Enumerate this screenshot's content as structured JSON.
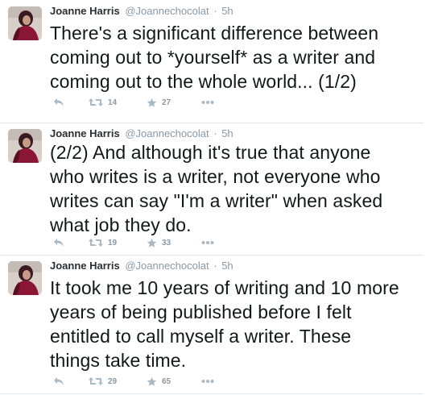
{
  "tweets": [
    {
      "fullname": "Joanne Harris",
      "username": "@Joannechocolat",
      "separator": "·",
      "time": "5h",
      "text": "There's a significant difference between\ncoming out to *yourself* as a writer and\ncoming out to the whole world... (1/2)",
      "retweets": "14",
      "favorites": "27"
    },
    {
      "fullname": "Joanne Harris",
      "username": "@Joannechocolat",
      "separator": "·",
      "time": "5h",
      "text": "(2/2) And although it's true that anyone\nwho writes is a writer, not everyone who\nwrites can say \"I'm a writer\" when asked\nwhat job they do.",
      "retweets": "19",
      "favorites": "33"
    },
    {
      "fullname": "Joanne Harris",
      "username": "@Joannechocolat",
      "separator": "·",
      "time": "5h",
      "text": "It took me 10 years of writing and 10 more\nyears of being published before I felt\nentitled to call myself a writer. These\nthings take time.",
      "retweets": "29",
      "favorites": "65"
    }
  ],
  "colors": {
    "text": "#14171a",
    "muted": "#8899a6",
    "icon": "#aab8c2",
    "divider": "#e1e8ed"
  },
  "icons": {
    "reply": "reply-icon",
    "retweet": "retweet-icon",
    "favorite": "star-icon",
    "more": "more-dots-icon"
  }
}
